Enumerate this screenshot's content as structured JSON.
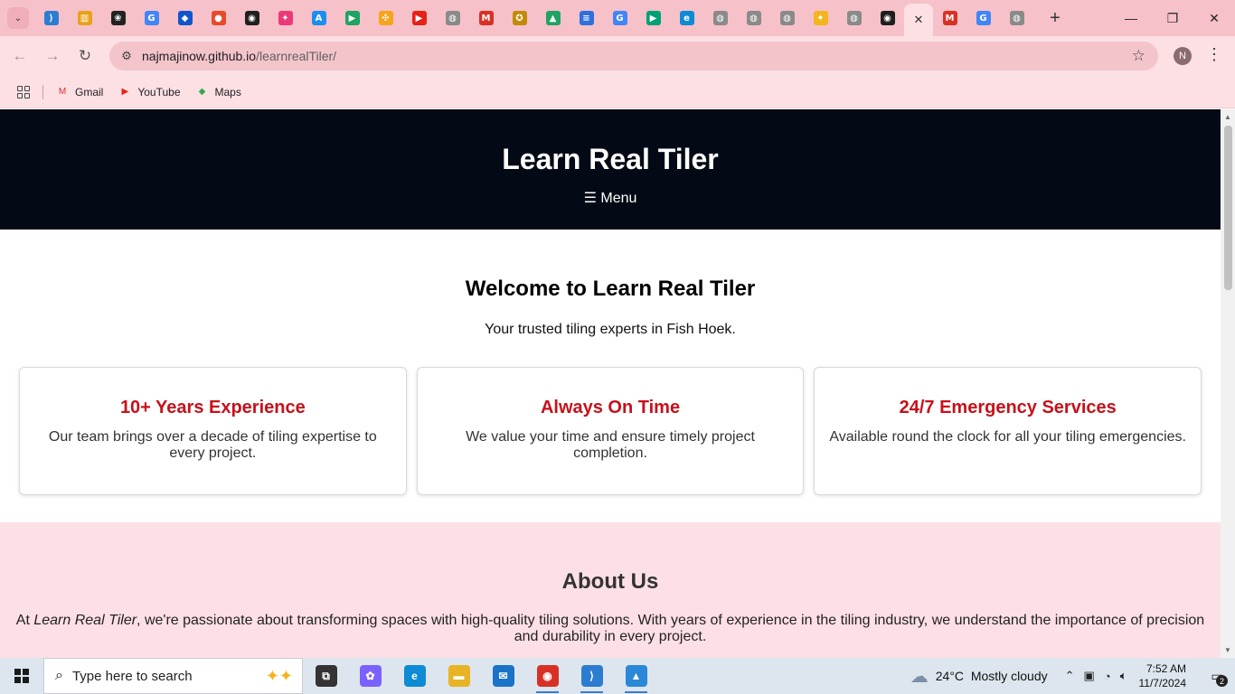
{
  "browser": {
    "tabs": [
      {
        "icon": "tab-search-icon",
        "label": "⌄",
        "color": "#f0aeb8"
      },
      {
        "icon": "vscode-icon",
        "label": "⟩",
        "color": "#2c7dd1"
      },
      {
        "icon": "chart-icon",
        "label": "▥",
        "color": "#e8a21a"
      },
      {
        "icon": "openai-icon",
        "label": "❀",
        "color": "#222222"
      },
      {
        "icon": "google-lens-icon",
        "label": "G",
        "color": "#4285f4"
      },
      {
        "icon": "jira-icon",
        "label": "◆",
        "color": "#1155cc"
      },
      {
        "icon": "red-app-icon",
        "label": "●",
        "color": "#e54b2b"
      },
      {
        "icon": "github-icon",
        "label": "◉",
        "color": "#1f1f1f"
      },
      {
        "icon": "bluesky-icon",
        "label": "✦",
        "color": "#ea3a78"
      },
      {
        "icon": "app-store-icon",
        "label": "A",
        "color": "#1b8ef2"
      },
      {
        "icon": "play-icon",
        "label": "▶",
        "color": "#1ea362"
      },
      {
        "icon": "pinwheel-icon",
        "label": "✣",
        "color": "#f4a51c"
      },
      {
        "icon": "youtube-icon",
        "label": "▶",
        "color": "#e62117"
      },
      {
        "icon": "globe-icon",
        "label": "◍",
        "color": "#8a8a8a"
      },
      {
        "icon": "gmail-icon",
        "label": "M",
        "color": "#d93025"
      },
      {
        "icon": "gold-app-icon",
        "label": "✪",
        "color": "#c28a07"
      },
      {
        "icon": "drive-icon",
        "label": "▲",
        "color": "#1fa463"
      },
      {
        "icon": "docs-icon",
        "label": "≡",
        "color": "#2f6fde"
      },
      {
        "icon": "google-icon",
        "label": "G",
        "color": "#4285f4"
      },
      {
        "icon": "play-icon",
        "label": "▶",
        "color": "#00a173"
      },
      {
        "icon": "edge-icon",
        "label": "e",
        "color": "#0f8ad4"
      },
      {
        "icon": "globe-icon",
        "label": "◍",
        "color": "#8a8a8a"
      },
      {
        "icon": "globe-icon",
        "label": "◍",
        "color": "#8a8a8a"
      },
      {
        "icon": "globe-icon",
        "label": "◍",
        "color": "#8a8a8a"
      },
      {
        "icon": "gemini-icon",
        "label": "✦",
        "color": "#f2b51c"
      },
      {
        "icon": "globe-icon",
        "label": "◍",
        "color": "#8a8a8a"
      },
      {
        "icon": "github-icon",
        "label": "◉",
        "color": "#1f1f1f"
      }
    ],
    "active_tab_close": "✕",
    "trailing_tabs": [
      {
        "icon": "gmail-icon",
        "label": "M",
        "color": "#d93025"
      },
      {
        "icon": "google-icon",
        "label": "G",
        "color": "#4285f4"
      },
      {
        "icon": "globe-icon",
        "label": "◍",
        "color": "#8a8a8a"
      }
    ],
    "new_tab": "+",
    "window_controls": {
      "minimize": "—",
      "restore": "❐",
      "close": "✕"
    },
    "nav": {
      "back": "←",
      "forward": "→",
      "reload": "↻"
    },
    "url_host": "najmajinow.github.io",
    "url_path": "/learnrealTiler/",
    "site_info_icon": "⚙",
    "bookmark_star": "☆",
    "profile_initial": "N",
    "menu_dots": "⋮",
    "bookmarks": [
      {
        "label": "Gmail",
        "icon": "gmail-icon",
        "glyph": "M",
        "color": "#d93025"
      },
      {
        "label": "YouTube",
        "icon": "youtube-icon",
        "glyph": "▶",
        "color": "#e62117"
      },
      {
        "label": "Maps",
        "icon": "maps-icon",
        "glyph": "◆",
        "color": "#34a853"
      }
    ]
  },
  "site": {
    "title": "Learn Real Tiler",
    "menu_label": "☰ Menu",
    "welcome_heading": "Welcome to Learn Real Tiler",
    "welcome_text": "Your trusted tiling experts in Fish Hoek.",
    "features": [
      {
        "title": "10+ Years Experience",
        "text": "Our team brings over a decade of tiling expertise to every project."
      },
      {
        "title": "Always On Time",
        "text": "We value your time and ensure timely project completion."
      },
      {
        "title": "24/7 Emergency Services",
        "text": "Available round the clock for all your tiling emergencies."
      }
    ],
    "about_heading": "About Us",
    "about_prefix": "At ",
    "about_name": "Learn Real Tiler",
    "about_text": ", we're passionate about transforming spaces with high-quality tiling solutions. With years of experience in the tiling industry, we understand the importance of precision and durability in every project.",
    "colors": {
      "header_bg": "#040a15",
      "accent_red": "#c8101a",
      "about_bg": "#fde0e5"
    }
  },
  "taskbar": {
    "search_placeholder": "Type here to search",
    "apps": [
      {
        "name": "task-view-icon",
        "glyph": "⧉",
        "color": "#333333",
        "running": false
      },
      {
        "name": "copilot-icon",
        "glyph": "✿",
        "color": "#7b61ff",
        "running": false
      },
      {
        "name": "edge-icon",
        "glyph": "e",
        "color": "#0f8ad4",
        "running": false
      },
      {
        "name": "file-explorer-icon",
        "glyph": "▬",
        "color": "#e8b325",
        "running": false
      },
      {
        "name": "mail-icon",
        "glyph": "✉",
        "color": "#1a73c8",
        "running": false
      },
      {
        "name": "chrome-icon",
        "glyph": "◉",
        "color": "#d93025",
        "running": true
      },
      {
        "name": "vscode-icon",
        "glyph": "⟩",
        "color": "#2c7dd1",
        "running": true
      },
      {
        "name": "photos-icon",
        "glyph": "▲",
        "color": "#2b88d8",
        "running": true
      }
    ],
    "weather_temp": "24°C",
    "weather_desc": "Mostly cloudy",
    "time": "7:52 AM",
    "date": "11/7/2024",
    "notification_count": "2"
  }
}
